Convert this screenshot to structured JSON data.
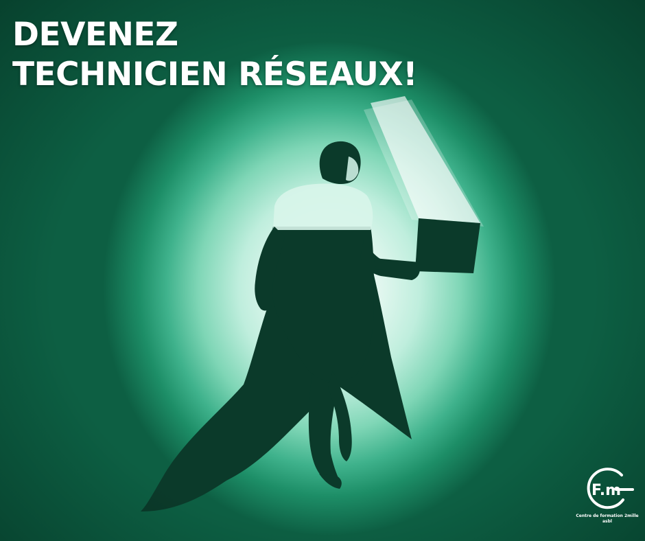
{
  "headline": {
    "line1": "DEVENEZ",
    "line2": "TECHNICIEN RÉSEAUX!"
  },
  "logo": {
    "mark_text": "F.m",
    "caption_line1": "Centre de formation 2mille",
    "caption_line2": "asbl"
  },
  "colors": {
    "background_dark": "#0d5f43",
    "background_glow": "#f4fffb",
    "silhouette": "#0b3a2a",
    "text": "#ffffff"
  },
  "icons": [
    "person-with-laptop-silhouette",
    "light-beam",
    "organization-logo"
  ]
}
